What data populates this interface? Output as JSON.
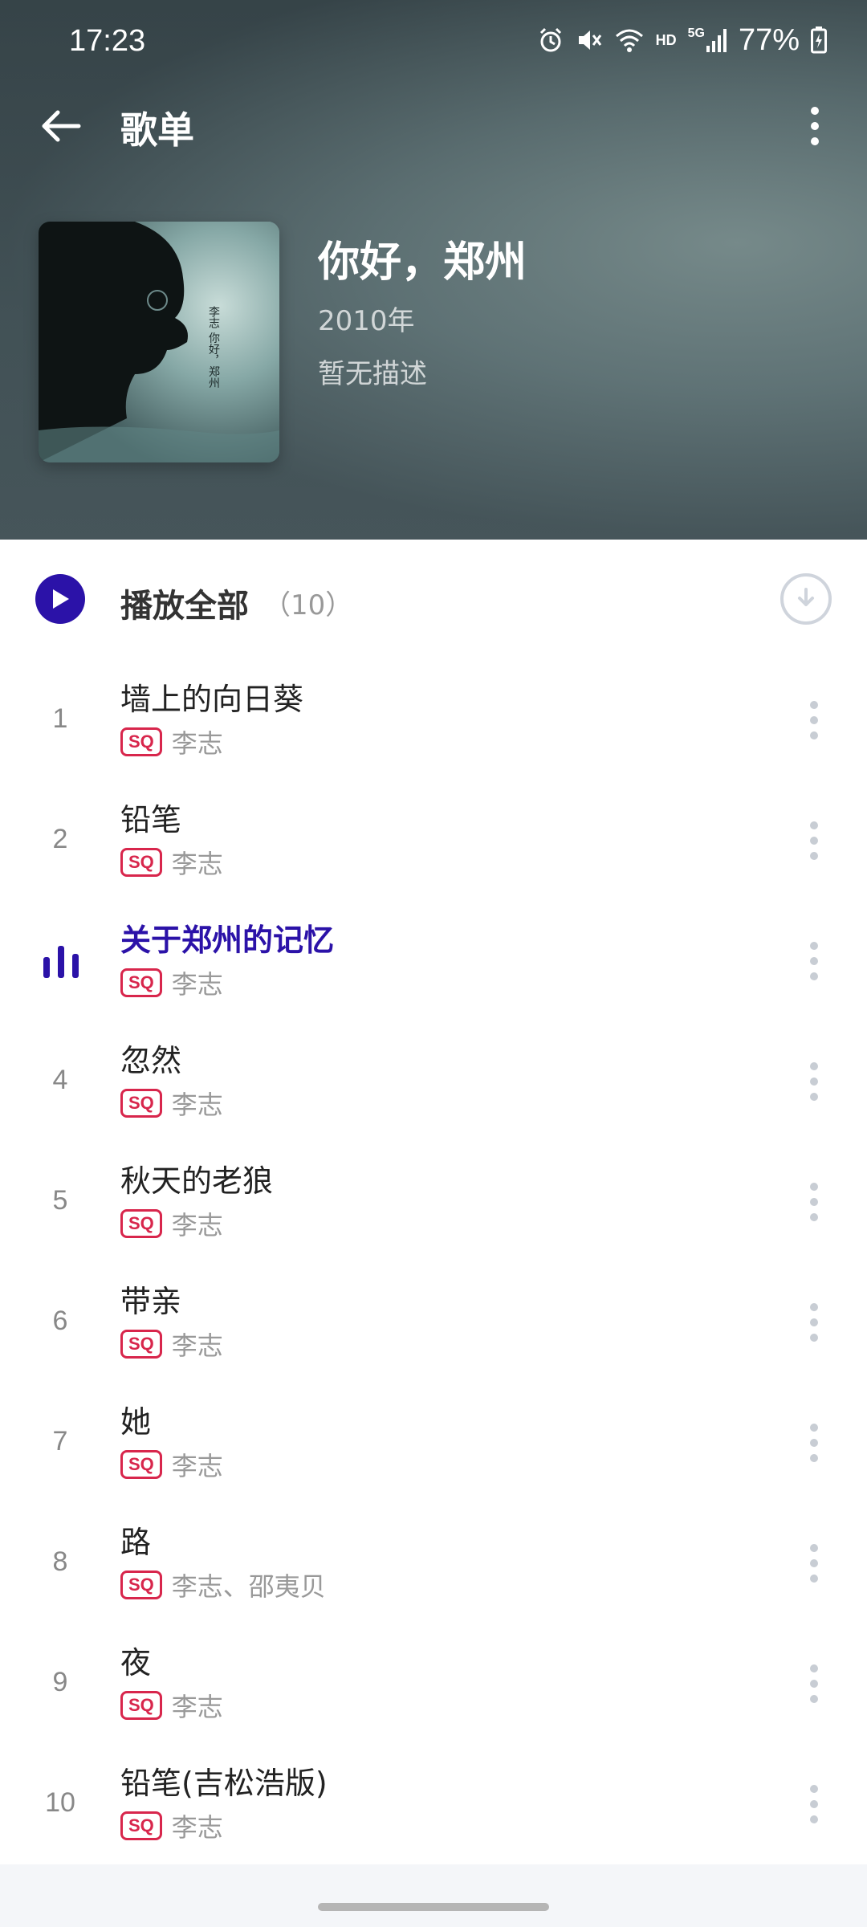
{
  "status_bar": {
    "time": "17:23",
    "battery": "77%",
    "icons": [
      "alarm-icon",
      "mute-icon",
      "wifi-icon",
      "hd-icon",
      "5g-signal-icon",
      "battery-icon"
    ],
    "hd_label": "HD",
    "network_label": "5G"
  },
  "top_bar": {
    "title": "歌单",
    "back_icon": "back-arrow-icon",
    "more_icon": "more-vertical-icon"
  },
  "album": {
    "title": "你好，郑州",
    "year": "2010年",
    "description": "暂无描述",
    "cover_text": "李志 你好，郑州"
  },
  "play_all": {
    "label": "播放全部",
    "count": "（10）"
  },
  "songs": [
    {
      "index": "1",
      "title": "墙上的向日葵",
      "badge": "SQ",
      "artist": "李志",
      "playing": false
    },
    {
      "index": "2",
      "title": "铅笔",
      "badge": "SQ",
      "artist": "李志",
      "playing": false
    },
    {
      "index": "3",
      "title": "关于郑州的记忆",
      "badge": "SQ",
      "artist": "李志",
      "playing": true
    },
    {
      "index": "4",
      "title": "忽然",
      "badge": "SQ",
      "artist": "李志",
      "playing": false
    },
    {
      "index": "5",
      "title": "秋天的老狼",
      "badge": "SQ",
      "artist": "李志",
      "playing": false
    },
    {
      "index": "6",
      "title": "带亲",
      "badge": "SQ",
      "artist": "李志",
      "playing": false
    },
    {
      "index": "7",
      "title": "她",
      "badge": "SQ",
      "artist": "李志",
      "playing": false
    },
    {
      "index": "8",
      "title": "路",
      "badge": "SQ",
      "artist": "李志、邵夷贝",
      "playing": false
    },
    {
      "index": "9",
      "title": "夜",
      "badge": "SQ",
      "artist": "李志",
      "playing": false
    },
    {
      "index": "10",
      "title": "铅笔(吉松浩版)",
      "badge": "SQ",
      "artist": "李志",
      "playing": false
    }
  ],
  "colors": {
    "accent": "#2b12a8",
    "sq_badge": "#d8264c",
    "secondary_text": "#999999"
  }
}
